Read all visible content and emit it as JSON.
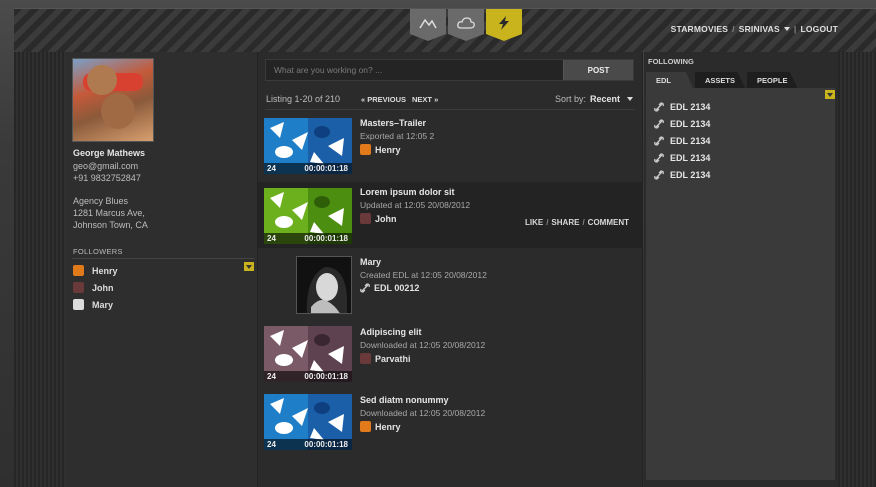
{
  "header": {
    "nav_icons": [
      "mountain-icon",
      "cloud-icon",
      "lightning-icon"
    ],
    "active_icon": "lightning-icon",
    "brand": "STARMOVIES",
    "user": "SRINIVAS",
    "logout": "LOGOUT"
  },
  "profile": {
    "name": "George Mathews",
    "email": "geo@gmail.com",
    "phone": "+91 9832752847",
    "agency": "Agency Blues",
    "address_line1": "1281 Marcus Ave,",
    "address_line2": "Johnson Town, CA",
    "followers_title": "FOLLOWERS",
    "followers": [
      {
        "name": "Henry",
        "avatar": "orange"
      },
      {
        "name": "John",
        "avatar": "dark"
      },
      {
        "name": "Mary",
        "avatar": "bw"
      }
    ]
  },
  "compose": {
    "placeholder": "What are you working on? ...",
    "post_label": "POST"
  },
  "listing": {
    "text": "Listing 1-20 of 210",
    "prev": "« PREVIOUS",
    "next": "NEXT »",
    "sort_label": "Sort by:",
    "sort_value": "Recent"
  },
  "feed": [
    {
      "title": "Masters–Trailer",
      "sub": "Exported at 12:05 2",
      "user": "Henry",
      "count": "24",
      "tc": "00:00:01:18",
      "palette": "blue"
    },
    {
      "title": "Lorem ipsum dolor sit",
      "sub": "Updated at 12:05 20/08/2012",
      "user": "John",
      "count": "24",
      "tc": "00:00:01:18",
      "palette": "green",
      "actions": {
        "like": "LIKE",
        "share": "SHARE",
        "comment": "COMMENT"
      }
    },
    {
      "title": "Mary",
      "sub": "Created EDL at 12:05 20/08/2012",
      "user": "EDL 00212"
    },
    {
      "title": "Adipiscing elit",
      "sub": "Downloaded at 12:05 20/08/2012",
      "user": "Parvathi",
      "count": "24",
      "tc": "00:00:01:18",
      "palette": "mauve"
    },
    {
      "title": "Sed diatm nonummy",
      "sub": "Downloaded at 12:05 20/08/2012",
      "user": "Henry",
      "count": "24",
      "tc": "00:00:01:18",
      "palette": "blue"
    }
  ],
  "following": {
    "title": "FOLLOWING",
    "tabs": [
      "EDL",
      "ASSETS",
      "PEOPLE"
    ],
    "active_tab": "EDL",
    "items": [
      "EDL 2134",
      "EDL 2134",
      "EDL 2134",
      "EDL 2134",
      "EDL 2134"
    ]
  },
  "colors": {
    "accent": "#c9b41e",
    "thumb_blue": "#1e7fc8",
    "thumb_green": "#6cb01e",
    "thumb_mauve": "#7a5a66"
  }
}
